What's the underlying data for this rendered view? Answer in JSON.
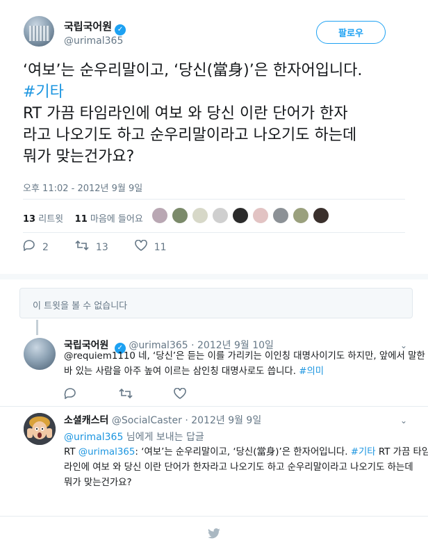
{
  "header": {
    "name": "국립국어원",
    "handle": "@urimal365",
    "follow_label": "팔로우"
  },
  "tweet": {
    "lines": [
      "‘여보’는 순우리말이고, ‘당신(當身)’은 한자어입니다.",
      "#기타",
      "RT 가끔 타임라인에 여보 와 당신 이란 단어가 한자",
      "라고 나오기도 하고 순우리말이라고 나오기도 하는데",
      "뭐가 맞는건가요?"
    ],
    "timestamp": "오후 11:02 - 2012년 9월 9일",
    "retweet_count": "13",
    "retweet_label": "리트윗",
    "like_count": "11",
    "like_label": "마음에 들어요",
    "reply_action_count": "2",
    "retweet_action_count": "13",
    "like_action_count": "11"
  },
  "unavailable_text": "이 트윗을 볼 수 없습니다",
  "reply1": {
    "name": "국립국어원",
    "handle": "@urimal365",
    "date": "· 2012년 9월 10일",
    "line1": "@requiem1110 네, ‘당신’은 듣는 이를 가리키는 이인칭 대명사이기도 하지만, 앞에서 말한",
    "line2_text": "바 있는 사람을 아주 높여 이르는 삼인칭 대명사로도 씁니다.",
    "line2_tag": "#의미"
  },
  "reply2": {
    "name": "소셜캐스터",
    "handle": "@SocialCaster",
    "date": "· 2012년 9월 9일",
    "reply_to_handle": "@urimal365",
    "reply_to_suffix": "님에게 보내는 답글",
    "line1_a": "RT",
    "line1_b": "@urimal365",
    "line1_c": ": ‘여보’는 순우리말이고, ‘당신(當身)’은 한자어입니다.",
    "line1_d": "#기타",
    "line1_e": "RT 가끔 타임",
    "line2": "라인에 여보 와 당신 이란 단어가 한자라고 나오기도 하고 순우리말이라고 나오기도 하는데",
    "line3": "뭐가 맞는건가요?"
  },
  "icons": {
    "verified": "verified-badge-icon",
    "reply": "reply-icon",
    "retweet": "retweet-icon",
    "like": "heart-icon",
    "more": "chevron-down-icon",
    "bird": "twitter-bird-icon"
  },
  "colors": {
    "accent": "#1da1f2",
    "link": "#1b95e0",
    "muted": "#657786"
  }
}
